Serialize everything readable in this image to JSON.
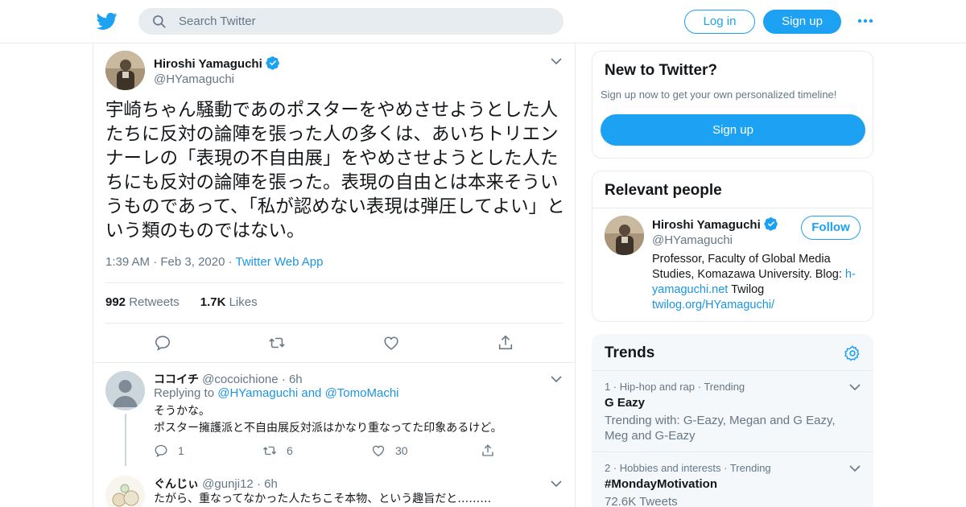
{
  "header": {
    "search_placeholder": "Search Twitter",
    "login_label": "Log in",
    "signup_label": "Sign up"
  },
  "tweet": {
    "author_name": "Hiroshi Yamaguchi",
    "author_handle": "@HYamaguchi",
    "text": "宇崎ちゃん騒動であのポスターをやめさせようとした人たちに反対の論陣を張った人の多くは、あいちトリエンナーレの「表現の不自由展」をやめさせようとした人たちにも反対の論陣を張った。表現の自由とは本来そういうものであって、「私が認めない表現は弾圧してよい」という類のものではない。",
    "time": "1:39 AM",
    "date": "Feb 3, 2020",
    "source": "Twitter Web App",
    "retweets_count": "992",
    "retweets_label": "Retweets",
    "likes_count": "1.7K",
    "likes_label": "Likes"
  },
  "replies": [
    {
      "name": "ココイチ",
      "handle": "@cocoichione",
      "age": "6h",
      "replying_prefix": "Replying to",
      "replying_to": "@HYamaguchi and @TomoMachi",
      "line1": "そうかな。",
      "line2": "ポスター擁護派と不自由展反対派はかなり重なってた印象あるけど。",
      "reply_count": "1",
      "retweet_count": "6",
      "like_count": "30"
    },
    {
      "name": "ぐんじぃ",
      "handle": "@gunji12",
      "age": "6h",
      "line1": "たがら、重なってなかった人たちこそ本物、という趣旨だと………"
    }
  ],
  "sidebar": {
    "new_title": "New to Twitter?",
    "new_subtitle": "Sign up now to get your own personalized timeline!",
    "new_signup_label": "Sign up",
    "relevant_title": "Relevant people",
    "person": {
      "name": "Hiroshi Yamaguchi",
      "handle": "@HYamaguchi",
      "follow_label": "Follow",
      "bio_text": "Professor, Faculty of Global Media Studies, Komazawa University. Blog:",
      "bio_link1": "h-yamaguchi.net",
      "bio_mid": "Twilog",
      "bio_link2": "twilog.org/HYamaguchi/"
    },
    "trends_title": "Trends",
    "trends": [
      {
        "meta": "1 · Hip-hop and rap · Trending",
        "name": "G Eazy",
        "desc": "Trending with: G-Eazy, Megan and G Eazy, Meg and G-Eazy"
      },
      {
        "meta": "2 · Hobbies and interests · Trending",
        "name": "#MondayMotivation",
        "desc": "72.6K Tweets"
      }
    ]
  },
  "colors": {
    "accent": "#1da1f2",
    "link": "#1b95e0",
    "muted": "#657786",
    "text": "#14171a",
    "border": "#e6ecf0"
  },
  "icons": [
    "twitter-bird-icon",
    "search-icon",
    "more-dots-icon",
    "verified-badge-icon",
    "chevron-down-icon",
    "reply-icon",
    "retweet-icon",
    "like-icon",
    "share-icon",
    "gear-icon"
  ]
}
